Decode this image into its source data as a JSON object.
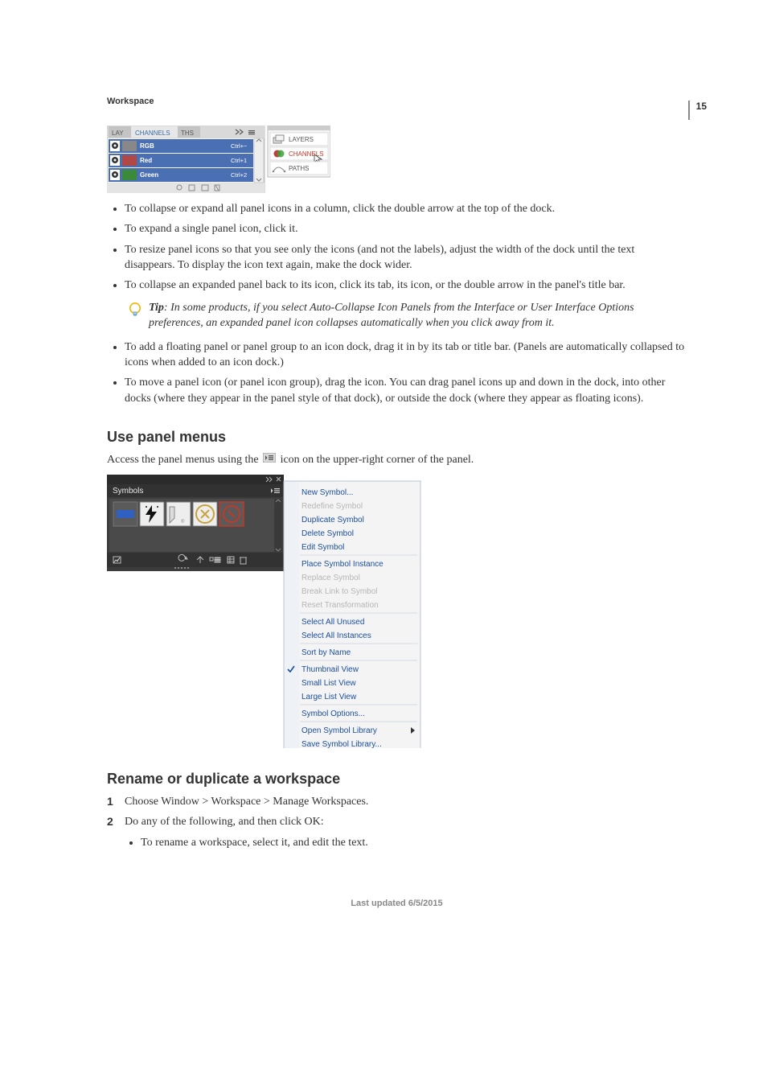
{
  "page_number": "15",
  "header_label": "Workspace",
  "fig1": {
    "tabs": [
      "LAY",
      "CHANNELS",
      "THS"
    ],
    "rows": [
      {
        "name": "RGB",
        "shortcut": "Ctrl+~"
      },
      {
        "name": "Red",
        "shortcut": "Ctrl+1"
      },
      {
        "name": "Green",
        "shortcut": "Ctrl+2"
      }
    ],
    "side_items": [
      "LAYERS",
      "CHANNELS",
      "PATHS"
    ]
  },
  "bullets1": {
    "items": [
      "To collapse or expand all panel icons in a column, click the double arrow at the top of the dock.",
      "To expand a single panel icon, click it.",
      "To resize panel icons so that you see only the icons (and not the labels), adjust the width of the dock until the text disappears. To display the icon text again, make the dock wider.",
      "To collapse an expanded panel back to its icon, click its tab, its icon, or the double arrow in the panel's title bar."
    ]
  },
  "tip": {
    "label": "Tip",
    "text": ": In some products, if you select Auto-Collapse Icon Panels from the Interface or User Interface Options preferences, an expanded panel icon collapses automatically when you click away from it."
  },
  "bullets2": {
    "items": [
      "To add a floating panel or panel group to an icon dock, drag it in by its tab or title bar. (Panels are automatically collapsed to icons when added to an icon dock.)",
      "To move a panel icon (or panel icon group), drag the icon. You can drag panel icons up and down in the dock, into other docks (where they appear in the panel style of that dock), or outside the dock (where they appear as floating icons)."
    ]
  },
  "section_panel_menus": {
    "title": "Use panel menus",
    "body_pre": "Access the panel menus using the ",
    "body_post": " icon on the upper-right corner of the panel."
  },
  "fig2": {
    "panel_title": "Symbols",
    "menu": {
      "groups": [
        [
          "New Symbol...",
          "Redefine Symbol",
          "Duplicate Symbol",
          "Delete Symbol",
          "Edit Symbol"
        ],
        [
          "Place Symbol Instance",
          "Replace Symbol",
          "Break Link to Symbol",
          "Reset Transformation"
        ],
        [
          "Select All Unused",
          "Select All Instances"
        ],
        [
          "Sort by Name"
        ],
        [
          "Thumbnail View",
          "Small List View",
          "Large List View"
        ],
        [
          "Symbol Options..."
        ],
        [
          "Open Symbol Library",
          "Save Symbol Library..."
        ]
      ],
      "disabled": [
        "Redefine Symbol",
        "Replace Symbol",
        "Break Link to Symbol",
        "Reset Transformation"
      ],
      "checked": "Thumbnail View",
      "submenu": "Open Symbol Library"
    }
  },
  "section_rename": {
    "title": "Rename or duplicate a workspace",
    "steps": [
      "Choose Window > Workspace > Manage Workspaces.",
      "Do any of the following, and then click OK:"
    ],
    "substeps": [
      "To rename a workspace, select it, and edit the text."
    ]
  },
  "footer": "Last updated 6/5/2015"
}
